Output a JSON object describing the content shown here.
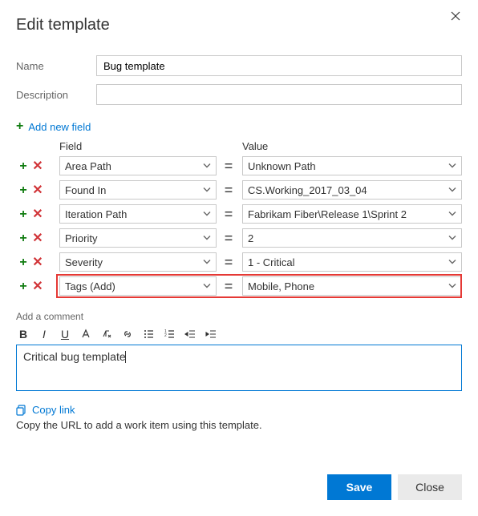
{
  "dialog": {
    "title": "Edit template",
    "name_label": "Name",
    "name_value": "Bug template",
    "description_label": "Description",
    "description_value": ""
  },
  "add_field_label": "Add new field",
  "headers": {
    "field": "Field",
    "value": "Value",
    "eq": "="
  },
  "rows": [
    {
      "field": "Area Path",
      "value": "Unknown Path",
      "highlighted": false
    },
    {
      "field": "Found In",
      "value": "CS.Working_2017_03_04",
      "highlighted": false
    },
    {
      "field": "Iteration Path",
      "value": "Fabrikam Fiber\\Release 1\\Sprint 2",
      "highlighted": false
    },
    {
      "field": "Priority",
      "value": "2",
      "highlighted": false
    },
    {
      "field": "Severity",
      "value": "1 - Critical",
      "highlighted": false
    },
    {
      "field": "Tags (Add)",
      "value": "Mobile, Phone",
      "highlighted": true
    }
  ],
  "comment": {
    "label": "Add a comment",
    "text": "Critical bug template"
  },
  "copy_link": {
    "label": "Copy link",
    "hint": "Copy the URL to add a work item using this template."
  },
  "buttons": {
    "save": "Save",
    "close": "Close"
  }
}
